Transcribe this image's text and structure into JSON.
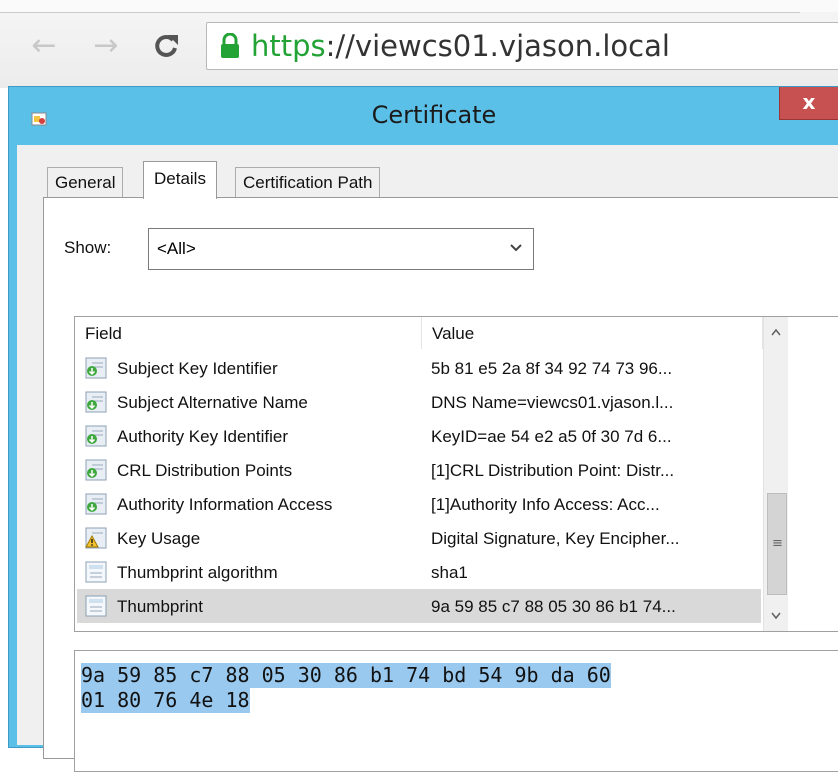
{
  "browser": {
    "url_scheme": "https",
    "url_rest": "://viewcs01.vjason.local",
    "back_icon": "←",
    "forward_icon": "→"
  },
  "dialog": {
    "title": "Certificate",
    "close_label": "x",
    "tabs": [
      "General",
      "Details",
      "Certification Path"
    ],
    "active_tab": "Details",
    "show_label": "Show:",
    "show_value": "<All>",
    "columns": [
      "Field",
      "Value"
    ],
    "fields": [
      {
        "name": "Subject Key Identifier",
        "value": "5b 81 e5 2a 8f 34 92 74 73 96...",
        "icon": "cert-field-green-icon"
      },
      {
        "name": "Subject Alternative Name",
        "value": "DNS Name=viewcs01.vjason.l...",
        "icon": "cert-field-icon"
      },
      {
        "name": "Authority Key Identifier",
        "value": "KeyID=ae 54 e2 a5 0f 30 7d 6...",
        "icon": "cert-field-green-icon"
      },
      {
        "name": "CRL Distribution Points",
        "value": "[1]CRL Distribution Point: Distr...",
        "icon": "cert-field-icon"
      },
      {
        "name": "Authority Information Access",
        "value": "[1]Authority Info Access: Acc...",
        "icon": "cert-field-icon"
      },
      {
        "name": "Key Usage",
        "value": "Digital Signature, Key Encipher...",
        "icon": "warning-field-icon"
      },
      {
        "name": "Thumbprint algorithm",
        "value": "sha1",
        "icon": "property-icon"
      },
      {
        "name": "Thumbprint",
        "value": "9a 59 85 c7 88 05 30 86 b1 74...",
        "icon": "property-icon"
      }
    ],
    "selected_field": "Thumbprint",
    "detail_lines": [
      "9a 59 85 c7 88 05 30 86 b1 74 bd 54 9b da 60",
      "01 80 76 4e 18"
    ]
  },
  "colors": {
    "titlebar": "#5bc0e8",
    "close": "#c75050",
    "secure_green": "#23a335",
    "selection": "#99c9ef"
  }
}
